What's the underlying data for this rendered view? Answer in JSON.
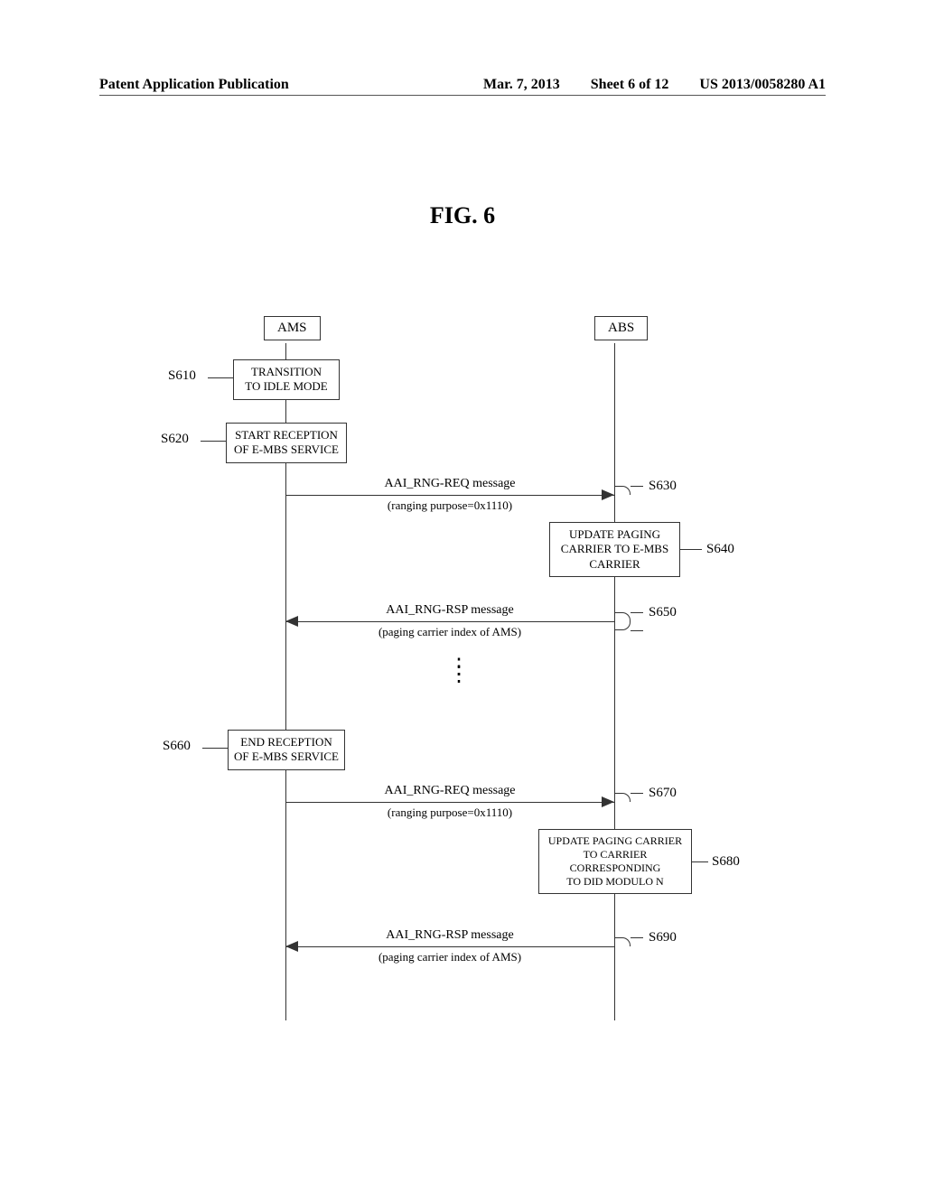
{
  "header": {
    "left": "Patent Application Publication",
    "date": "Mar. 7, 2013",
    "sheet": "Sheet 6 of 12",
    "pubid": "US 2013/0058280 A1"
  },
  "fig_title": "FIG. 6",
  "actors": {
    "ams": "AMS",
    "abs": "ABS"
  },
  "steps": {
    "s610": {
      "id": "S610",
      "text_l1": "TRANSITION",
      "text_l2": "TO IDLE MODE"
    },
    "s620": {
      "id": "S620",
      "text_l1": "START RECEPTION",
      "text_l2": "OF E-MBS SERVICE"
    },
    "s630": {
      "id": "S630",
      "msg": "AAI_RNG-REQ message",
      "sub": "(ranging purpose=0x1110)"
    },
    "s640": {
      "id": "S640",
      "text_l1": "UPDATE PAGING",
      "text_l2": "CARRIER TO E-MBS",
      "text_l3": "CARRIER"
    },
    "s650": {
      "id": "S650",
      "msg": "AAI_RNG-RSP message",
      "sub": "(paging carrier index of AMS)"
    },
    "s660": {
      "id": "S660",
      "text_l1": "END RECEPTION",
      "text_l2": "OF E-MBS SERVICE"
    },
    "s670": {
      "id": "S670",
      "msg": "AAI_RNG-REQ message",
      "sub": "(ranging purpose=0x1110)"
    },
    "s680": {
      "id": "S680",
      "text_l1": "UPDATE PAGING CARRIER",
      "text_l2": "TO CARRIER",
      "text_l3": "CORRESPONDING",
      "text_l4": "TO DID MODULO N"
    },
    "s690": {
      "id": "S690",
      "msg": "AAI_RNG-RSP message",
      "sub": "(paging carrier index of AMS)"
    }
  }
}
